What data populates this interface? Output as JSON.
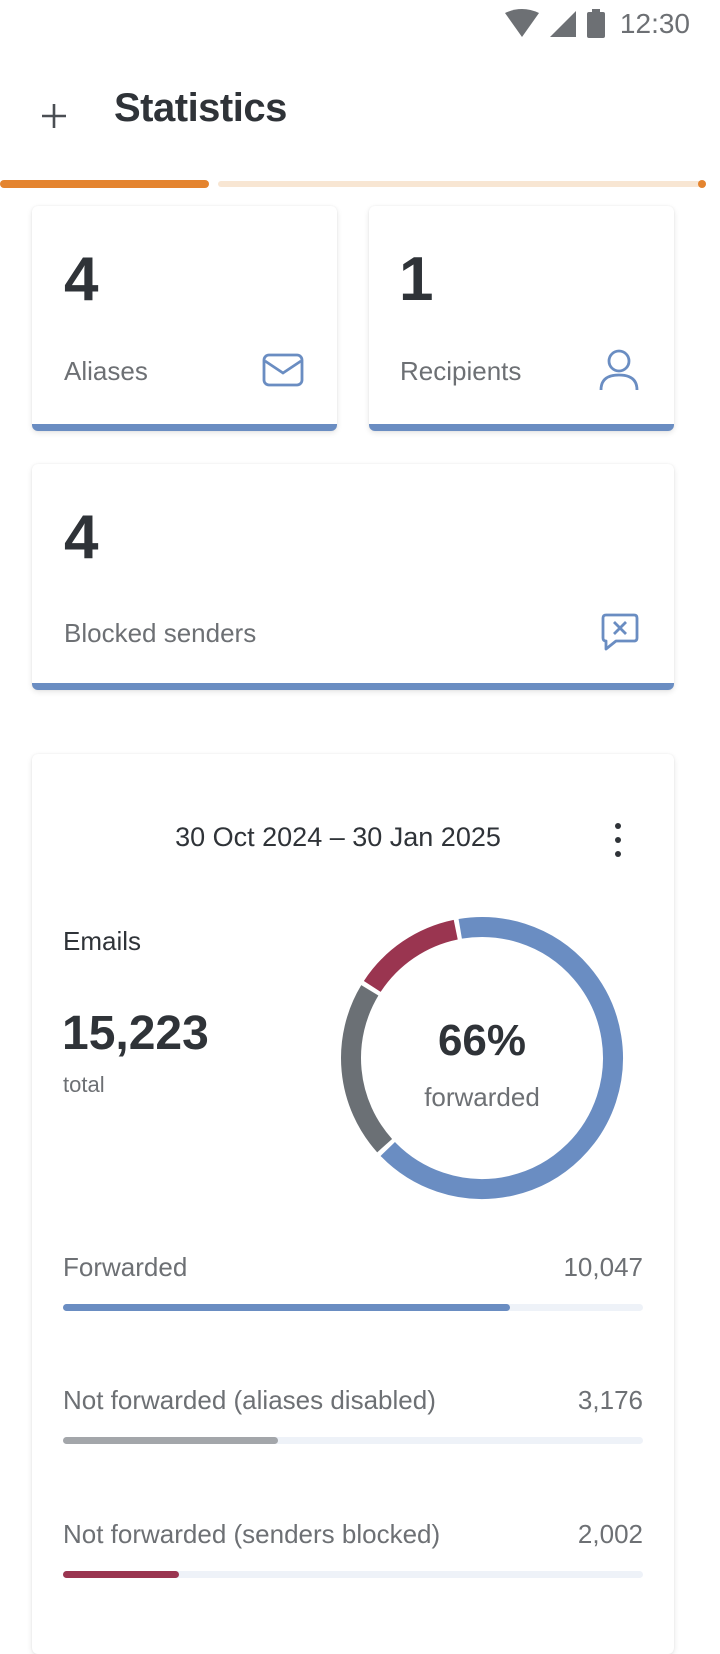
{
  "status_bar": {
    "time": "12:30"
  },
  "header": {
    "title": "Statistics"
  },
  "progress": {
    "value": 0.29
  },
  "cards": {
    "aliases": {
      "count": "4",
      "label": "Aliases"
    },
    "recipients": {
      "count": "1",
      "label": "Recipients"
    },
    "blocked": {
      "count": "4",
      "label": "Blocked senders"
    }
  },
  "emails": {
    "date_range": "30 Oct 2024 – 30 Jan 2025",
    "label": "Emails",
    "total": "15,223",
    "total_label": "total",
    "percent": "66%",
    "percent_label": "forwarded",
    "rows": [
      {
        "label": "Forwarded",
        "value": "10,047",
        "fraction": 0.77,
        "color": "#6a8dc2"
      },
      {
        "label": "Not forwarded (aliases disabled)",
        "value": "3,176",
        "fraction": 0.37,
        "color": "#a3a6aa"
      },
      {
        "label": "Not forwarded (senders blocked)",
        "value": "2,002",
        "fraction": 0.2,
        "color": "#9a3550"
      }
    ]
  },
  "colors": {
    "accent": "#e4842f",
    "card_accent": "#6a8dc2",
    "forwarded": "#6a8dc2",
    "disabled": "#6b7075",
    "blocked": "#9a3550"
  },
  "chart_data": {
    "type": "pie",
    "series": [
      {
        "name": "Forwarded",
        "values": [
          10047
        ]
      },
      {
        "name": "Not forwarded (aliases disabled)",
        "values": [
          3176
        ]
      },
      {
        "name": "Not forwarded (senders blocked)",
        "values": [
          2002
        ]
      }
    ]
  }
}
